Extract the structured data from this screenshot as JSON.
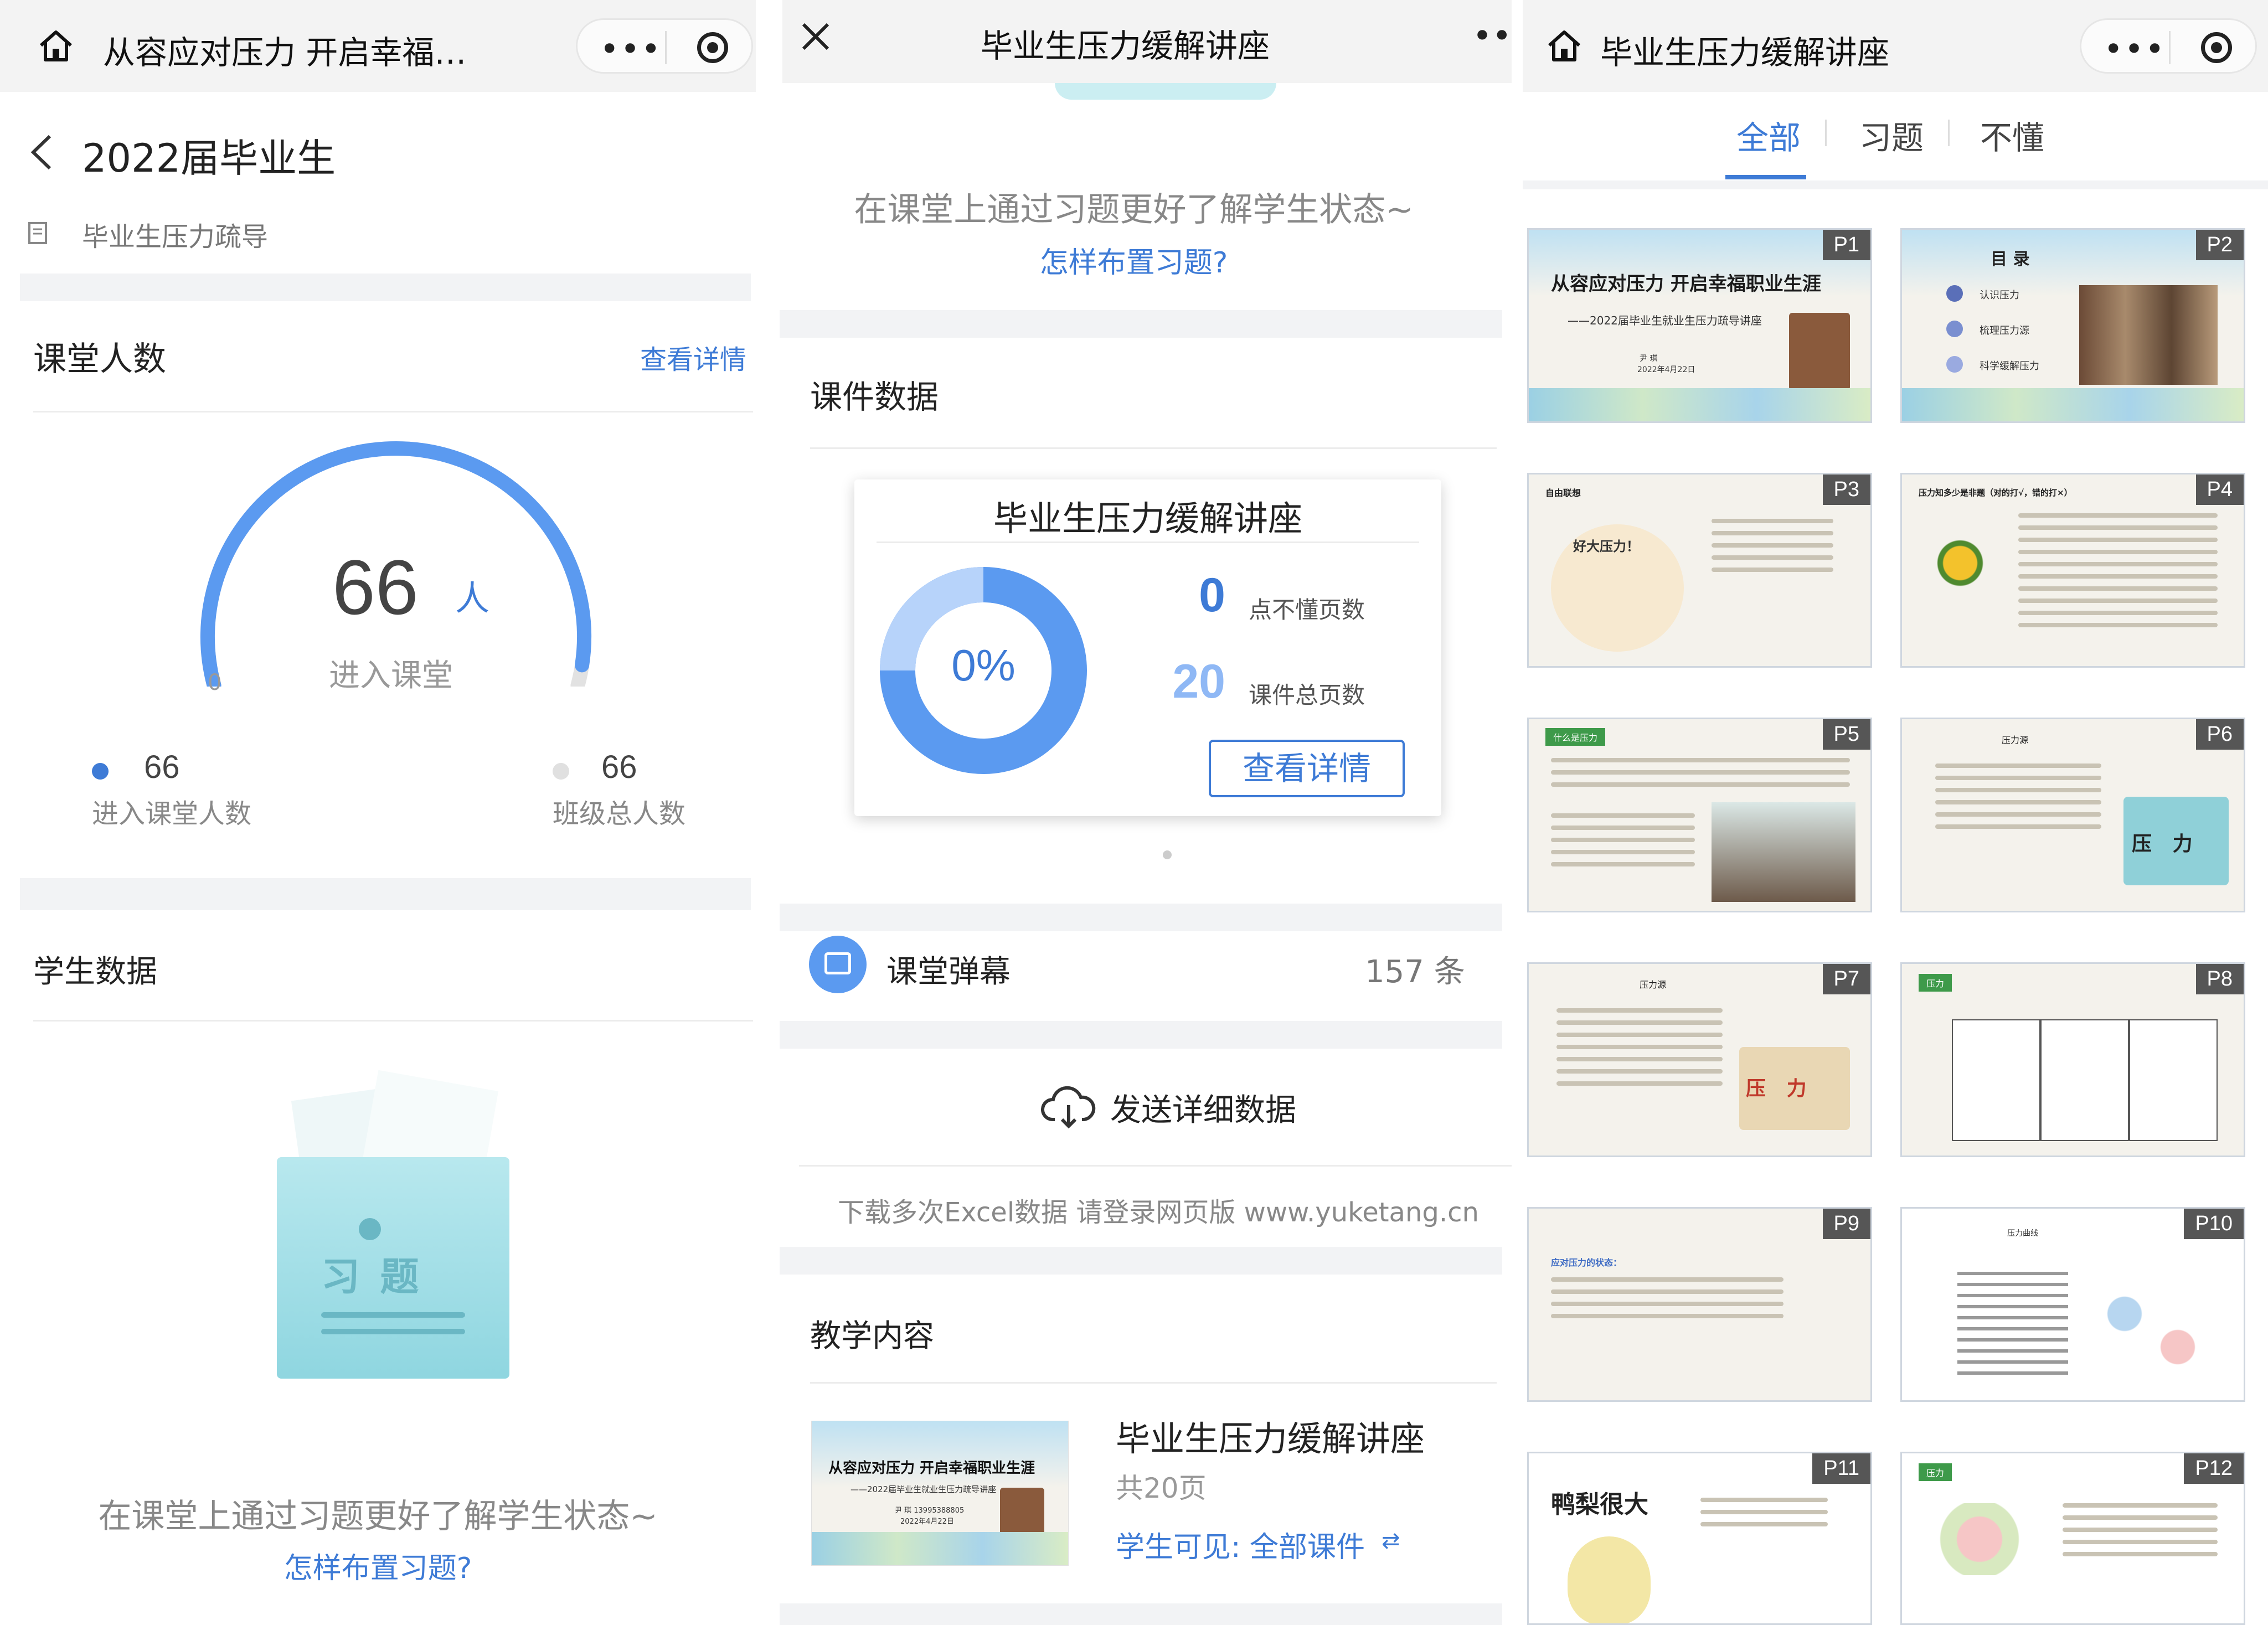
{
  "panel1": {
    "nav_title": "从容应对压力 开启幸福…",
    "back_title": "2022届毕业生",
    "course_name": "毕业生压力疏导",
    "attendance": {
      "section_title": "课堂人数",
      "details_link": "查看详情",
      "count": "66",
      "unit": "人",
      "label": "进入课堂",
      "gauge_min": "0",
      "gauge_fraction": 1.0,
      "entered_value": "66",
      "entered_label": "进入课堂人数",
      "total_value": "66",
      "total_label": "班级总人数"
    },
    "student_data": {
      "section_title": "学生数据",
      "illustration_text": "习 题",
      "empty_text": "在课堂上通过习题更好了解学生状态~",
      "help_link": "怎样布置习题?"
    }
  },
  "panel2": {
    "nav_title": "毕业生压力缓解讲座",
    "empty_text": "在课堂上通过习题更好了解学生状态~",
    "help_link": "怎样布置习题?",
    "courseware": {
      "section_title": "课件数据",
      "card_title": "毕业生压力缓解讲座",
      "percent": "0%",
      "percent_value": 0,
      "not_understood_value": "0",
      "not_understood_label": "点不懂页数",
      "total_pages_value": "20",
      "total_pages_label": "课件总页数",
      "details_button": "查看详情"
    },
    "danmaku": {
      "label": "课堂弹幕",
      "count": "157 条"
    },
    "send_data": {
      "label": "发送详细数据",
      "hint": "下载多次Excel数据 请登录网页版 www.yuketang.cn"
    },
    "teaching": {
      "section_title": "教学内容",
      "item_title": "毕业生压力缓解讲座",
      "pages": "共20页",
      "visibility": "学生可见: 全部课件",
      "thumb_title": "从容应对压力  开启幸福职业生涯",
      "thumb_sub": "——2022届毕业生就业生压力疏导讲座",
      "thumb_speaker": "尹 琪 13995388805",
      "thumb_date": "2022年4月22日"
    }
  },
  "panel3": {
    "nav_title": "毕业生压力缓解讲座",
    "tabs": [
      "全部",
      "习题",
      "不懂"
    ],
    "active_tab": 0,
    "slides": [
      {
        "tag": "P1",
        "title": "从容应对压力  开启幸福职业生涯",
        "sub": "——2022届毕业生就业生压力疏导讲座",
        "speaker": "尹 琪",
        "date": "2022年4月22日"
      },
      {
        "tag": "P2",
        "title": "目 录",
        "items": [
          "认识压力",
          "梳理压力源",
          "科学缓解压力"
        ]
      },
      {
        "tag": "P3",
        "title": "自由联想",
        "art": "好大压力！"
      },
      {
        "tag": "P4",
        "title": "压力知多少是非题（对的打√，错的打×）"
      },
      {
        "tag": "P5",
        "title": "什么是压力"
      },
      {
        "tag": "P6",
        "title": "压力源",
        "art": "压   力"
      },
      {
        "tag": "P7",
        "title": "压力源",
        "art": "压   力"
      },
      {
        "tag": "P8",
        "title": "压力"
      },
      {
        "tag": "P9",
        "title": "应对压力的状态："
      },
      {
        "tag": "P10",
        "title": "压力曲线"
      },
      {
        "tag": "P11",
        "title": "鸭梨很大"
      },
      {
        "tag": "P12",
        "title": "压力"
      }
    ]
  },
  "colors": {
    "accent": "#3e7bd6",
    "gauge": "#5b9af0",
    "donut_track": "#5b9af0",
    "gray_bg": "#f2f3f5"
  }
}
